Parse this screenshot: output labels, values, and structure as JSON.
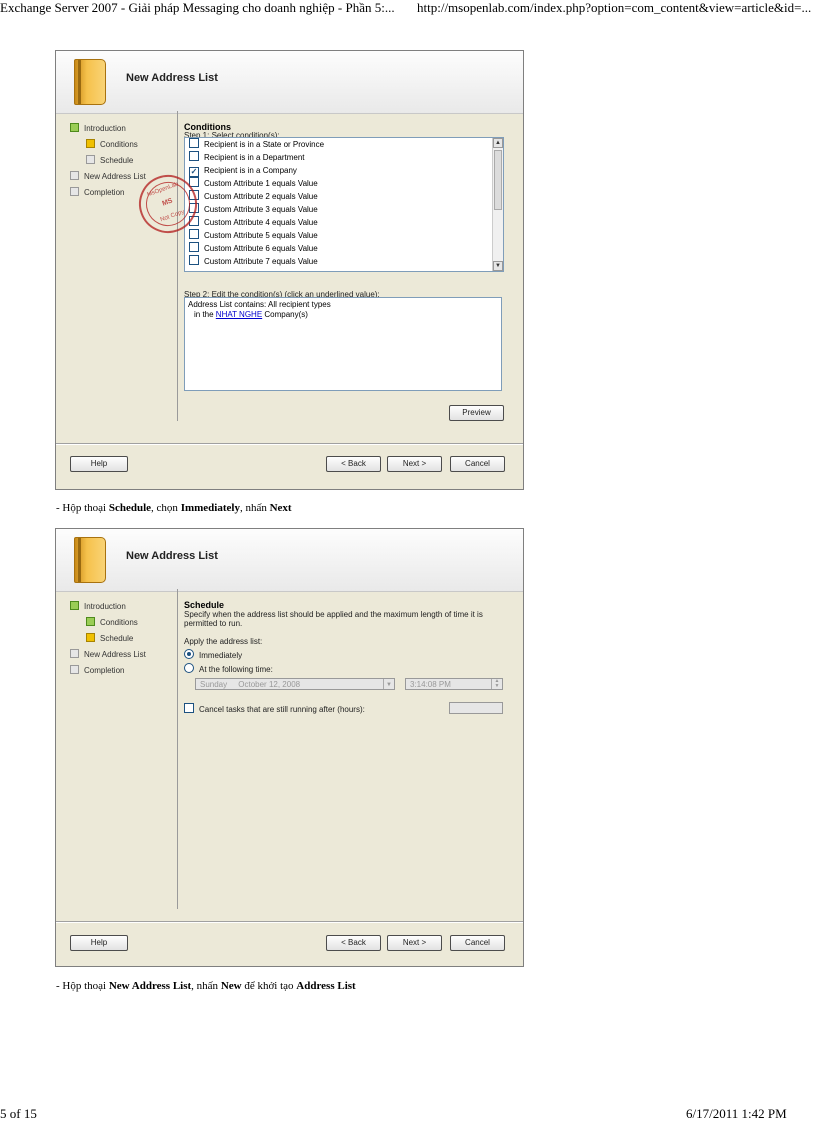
{
  "page": {
    "header_left": "Exchange Server 2007 - Giải pháp Messaging cho doanh nghiệp - Phần 5:...",
    "header_right": "http://msopenlab.com/index.php?option=com_content&view=article&id=...",
    "footer_left": "5 of 15",
    "footer_right": "6/17/2011 1:42 PM"
  },
  "captions": {
    "c1_prefix": "- Hộp thoại ",
    "c1_b1": "Schedule",
    "c1_mid1": ", chọn ",
    "c1_b2": "Immediately",
    "c1_mid2": ", nhấn ",
    "c1_b3": "Next",
    "c2_prefix": "- Hộp thoại ",
    "c2_b1": "New Address List",
    "c2_mid1": ", nhấn ",
    "c2_b2": "New",
    "c2_mid2": " để khởi tạo ",
    "c2_b3": "Address List"
  },
  "wizard": {
    "title": "New Address List",
    "steps": [
      "Introduction",
      "Conditions",
      "Schedule",
      "New Address List",
      "Completion"
    ],
    "buttons": {
      "help": "Help",
      "back": "< Back",
      "next": "Next >",
      "cancel": "Cancel",
      "preview": "Preview"
    }
  },
  "conditions": {
    "section_title": "Conditions",
    "step1_label": "Step 1: Select condition(s):",
    "items": [
      {
        "label": "Recipient is in a State or Province",
        "checked": false
      },
      {
        "label": "Recipient is in a Department",
        "checked": false
      },
      {
        "label": "Recipient is in a Company",
        "checked": true
      },
      {
        "label": "Custom Attribute 1 equals Value",
        "checked": false
      },
      {
        "label": "Custom Attribute 2 equals Value",
        "checked": false
      },
      {
        "label": "Custom Attribute 3 equals Value",
        "checked": false
      },
      {
        "label": "Custom Attribute 4 equals Value",
        "checked": false
      },
      {
        "label": "Custom Attribute 5 equals Value",
        "checked": false
      },
      {
        "label": "Custom Attribute 6 equals Value",
        "checked": false
      },
      {
        "label": "Custom Attribute 7 equals Value",
        "checked": false
      }
    ],
    "step2_label": "Step 2: Edit the condition(s) (click an underlined value):",
    "edit_line1": "Address List contains: All recipient types",
    "edit_line2_prefix": "in the ",
    "edit_line2_link": "NHAT NGHE",
    "edit_line2_suffix": " Company(s)"
  },
  "schedule": {
    "section_title": "Schedule",
    "description": "Specify when the address list should be applied and the maximum length of time it is permitted to run.",
    "apply_label": "Apply the address list:",
    "option_immediately": "Immediately",
    "option_following": "At the following time:",
    "date_day": "Sunday",
    "date_text": "October  12, 2008",
    "time_value": "3:14:08 PM",
    "cancel_tasks_label": "Cancel tasks that are still running after (hours):"
  },
  "stamp": {
    "line1": "MsOpenLab",
    "line2": "MS",
    "line3": "Not Copy"
  }
}
